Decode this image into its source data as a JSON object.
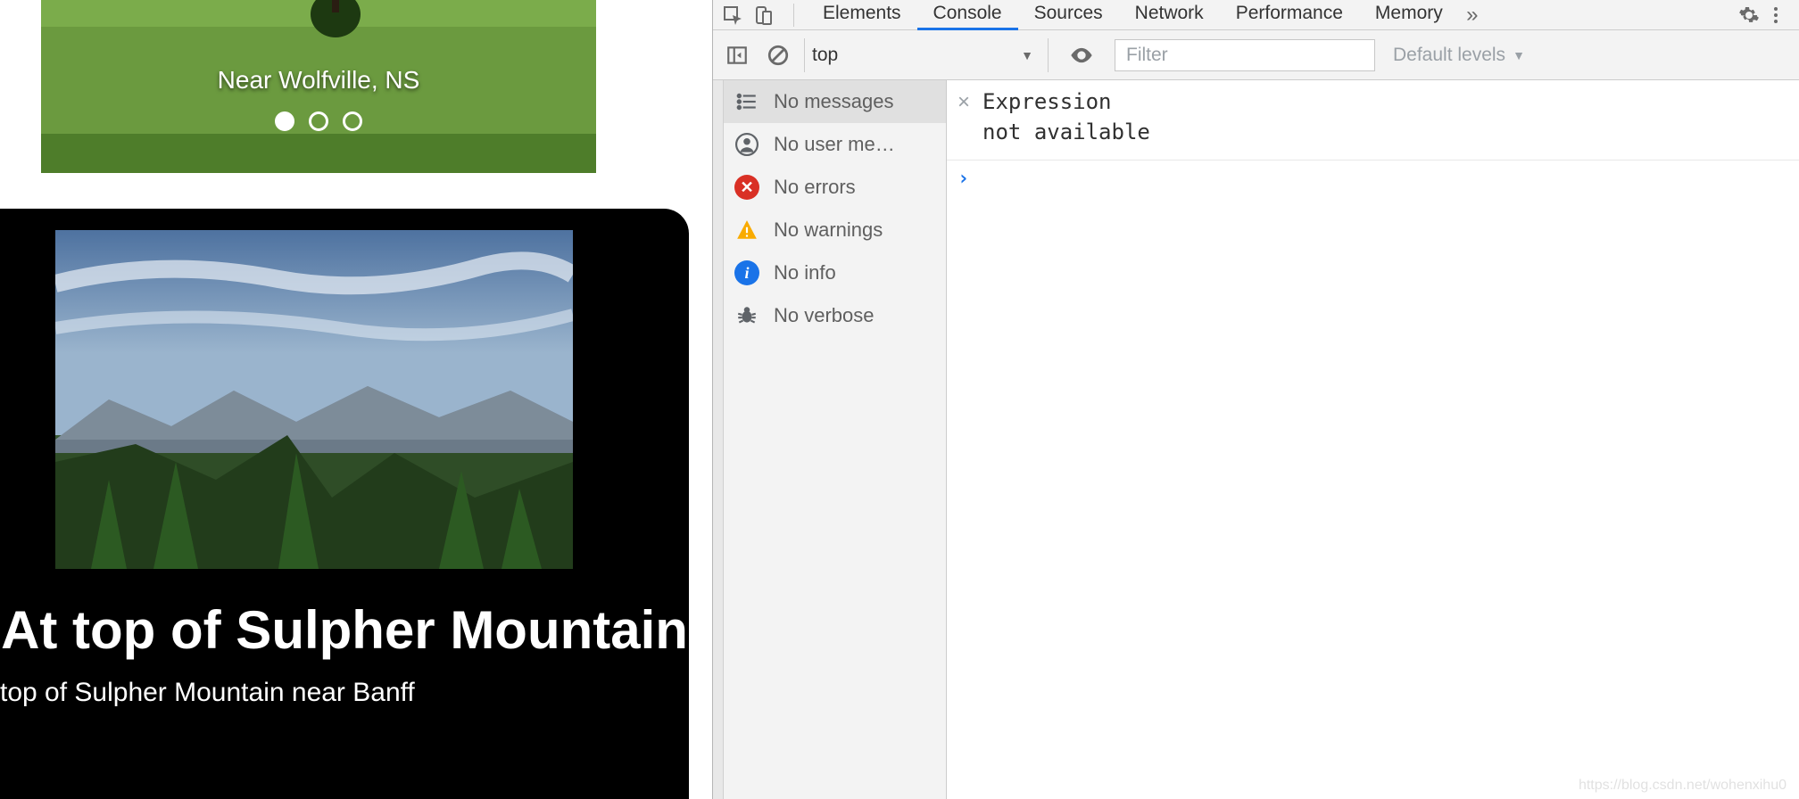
{
  "page": {
    "carousel": {
      "caption": "Near Wolfville, NS"
    },
    "card": {
      "title": "At top of Sulpher Mountain",
      "subtitle": "top of Sulpher Mountain near Banff"
    }
  },
  "devtools": {
    "tabs": {
      "elements": "Elements",
      "console": "Console",
      "sources": "Sources",
      "network": "Network",
      "performance": "Performance",
      "memory": "Memory",
      "overflow": "»"
    },
    "toolbar": {
      "context": "top",
      "filter_placeholder": "Filter",
      "levels": "Default levels"
    },
    "sidebar": {
      "messages": "No messages",
      "user": "No user me…",
      "errors": "No errors",
      "warnings": "No warnings",
      "info": "No info",
      "verbose": "No verbose"
    },
    "console": {
      "expression_line1": "Expression",
      "expression_line2": "not available",
      "close": "×",
      "prompt": "›"
    },
    "watermark": "https://blog.csdn.net/wohenxihu0"
  }
}
